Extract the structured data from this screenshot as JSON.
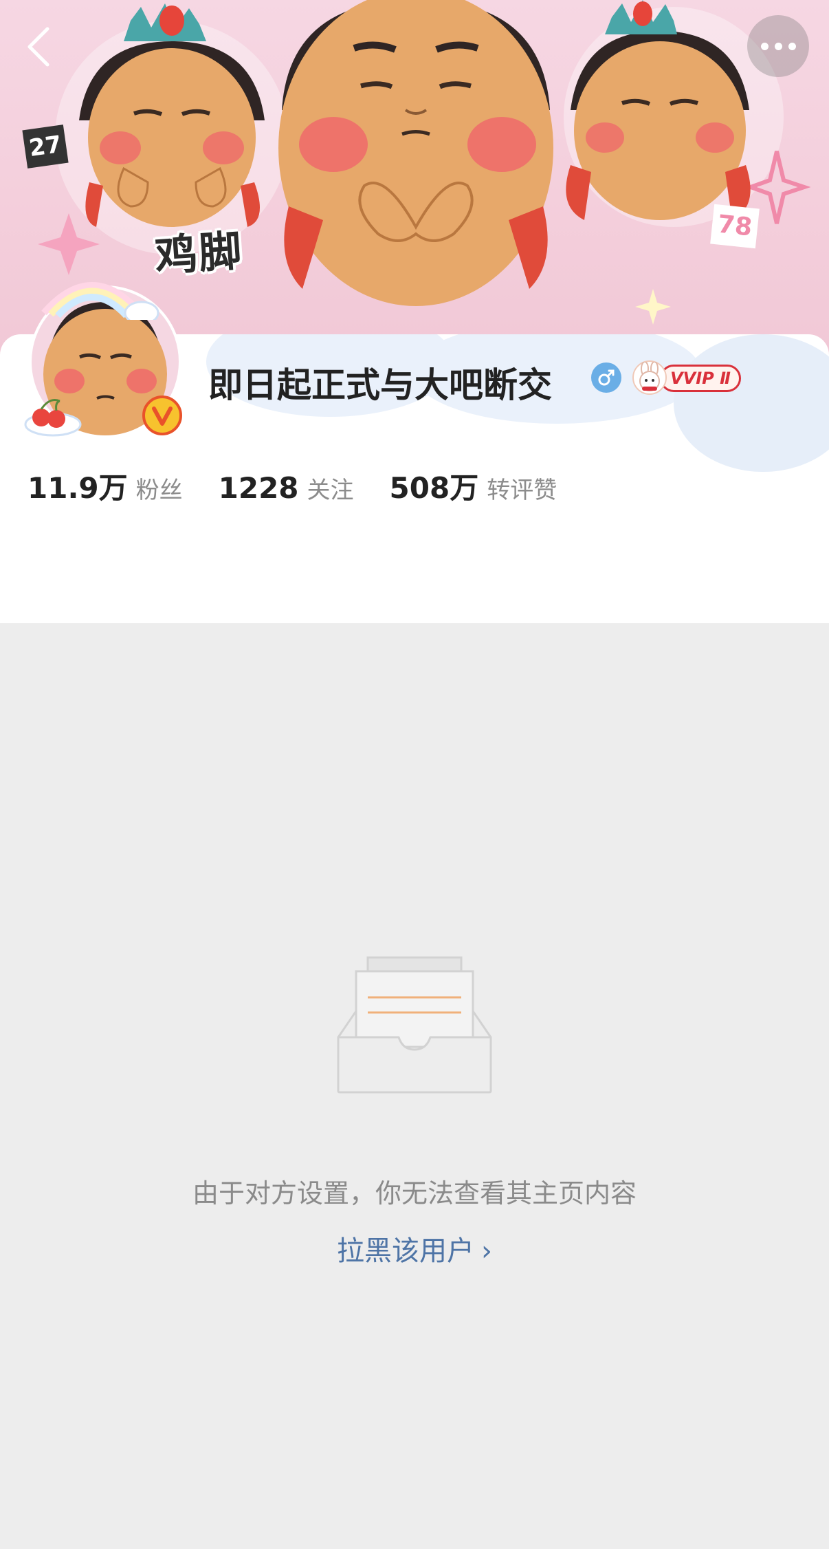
{
  "cover": {
    "tag_left": "27",
    "tag_right": "78",
    "sticker_text": "鸡脚"
  },
  "nav": {
    "back_icon": "chevron-left-icon",
    "more_icon": "more-dots-icon"
  },
  "profile": {
    "nickname": "即日起正式与大吧断交",
    "gender_icon": "male-icon",
    "vvip_label": "VVIP Ⅱ",
    "verified_badge": "V"
  },
  "stats": [
    {
      "value": "11.9万",
      "label": "粉丝"
    },
    {
      "value": "1228",
      "label": "关注"
    },
    {
      "value": "508万",
      "label": "转评赞"
    }
  ],
  "empty_state": {
    "message": "由于对方设置，你无法查看其主页内容",
    "action_label": "拉黑该用户",
    "action_chevron": "›"
  },
  "colors": {
    "background": "#ededed",
    "link": "#4e74a6",
    "gender": "#6aaee6",
    "vvip": "#d9303a"
  }
}
